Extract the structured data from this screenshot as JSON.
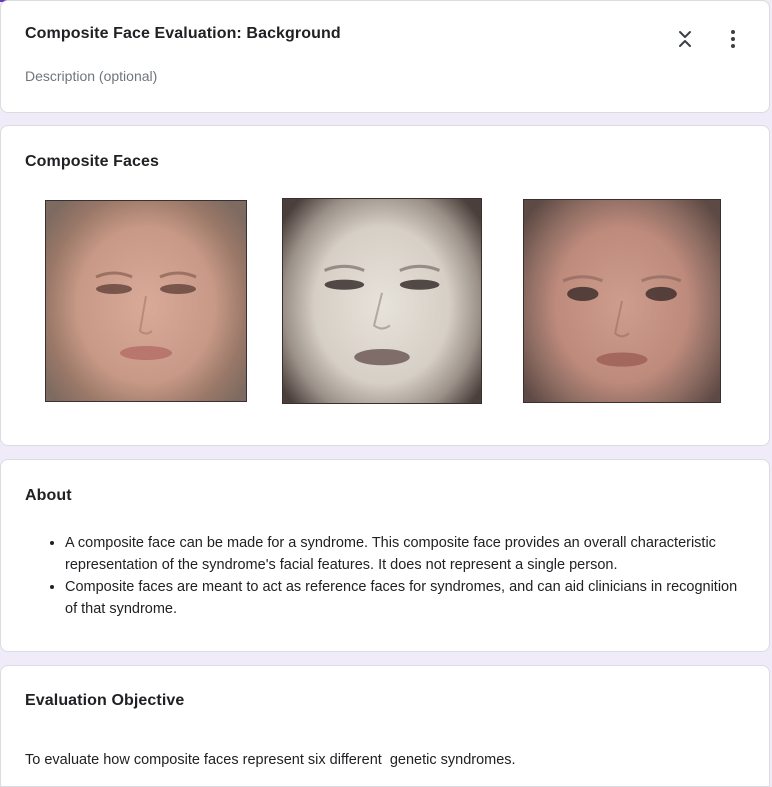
{
  "header": {
    "title": "Composite Face Evaluation: Background",
    "description_placeholder": "Description (optional)",
    "collapse_icon": "collapse-icon",
    "more_icon": "more-vert-icon"
  },
  "faces_section": {
    "title": "Composite Faces",
    "images": [
      {
        "name": "composite-face-image-1"
      },
      {
        "name": "composite-face-image-2"
      },
      {
        "name": "composite-face-image-3"
      }
    ]
  },
  "about": {
    "title": "About",
    "bullets": [
      "A composite face can be made for a syndrome. This composite face provides an overall characteristic representation of the syndrome's facial features. It does not represent a single person.",
      "Composite faces are meant to act as reference faces for syndromes, and can aid clinicians in recognition of that syndrome."
    ]
  },
  "objective": {
    "title": "Evaluation Objective",
    "text": "To evaluate how composite faces represent six different  genetic syndromes."
  },
  "colors": {
    "accent": "#673ab7",
    "page_background": "#f0ebf8",
    "card_border": "#dadce0",
    "muted_text": "#70757a"
  }
}
